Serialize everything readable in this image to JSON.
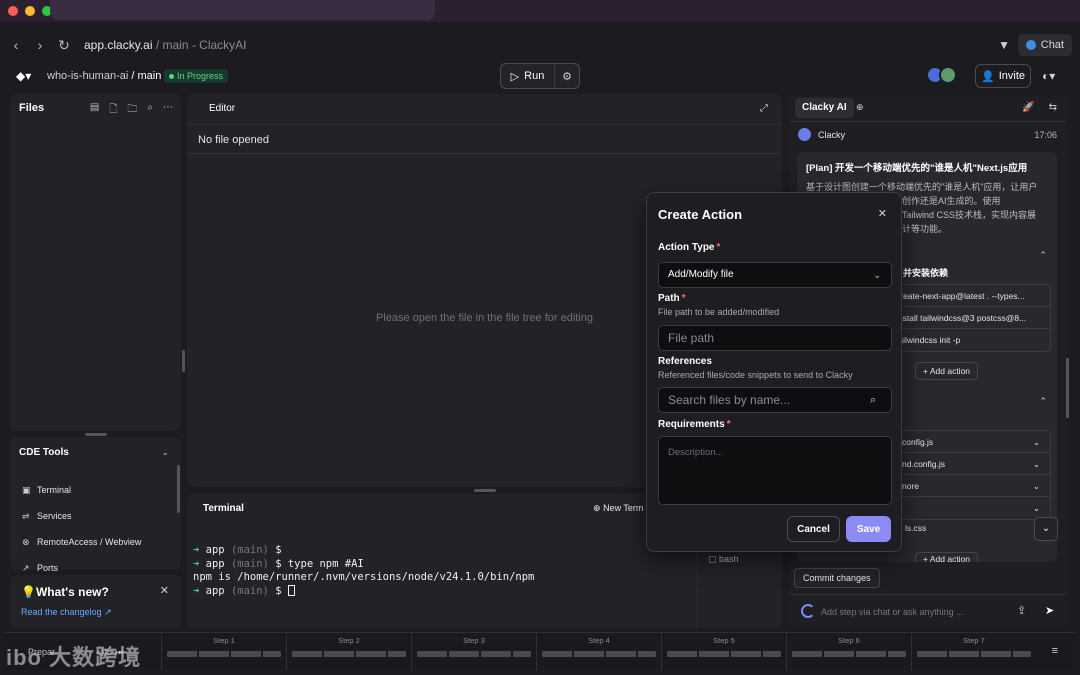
{
  "browser": {
    "url_host": "app.clacky.ai",
    "url_rest": " / main - ClackyAI",
    "chat_label": "Chat"
  },
  "header": {
    "project": "who-is-human-ai",
    "separator": "/",
    "branch": "main",
    "status": "In Progress",
    "run_label": "Run",
    "invite_label": "Invite"
  },
  "files": {
    "title": "Files"
  },
  "cde": {
    "title": "CDE Tools",
    "items": [
      {
        "icon": "terminal-icon",
        "label": "Terminal"
      },
      {
        "icon": "services-icon",
        "label": "Services"
      },
      {
        "icon": "remote-icon",
        "label": "RemoteAccess / Webview"
      },
      {
        "icon": "ports-icon",
        "label": "Ports"
      }
    ]
  },
  "news": {
    "title": "What's new?",
    "link": "Read the changelog ↗"
  },
  "editor": {
    "title": "Editor",
    "no_file": "No file opened",
    "empty_hint": "Please open the file in the file tree for editing"
  },
  "terminal": {
    "title": "Terminal",
    "new_terminal": "New Term",
    "side_tab": "bash",
    "lines": [
      {
        "arrow": "➜",
        "dir": "app",
        "branch": "(main)",
        "cmd": "$"
      },
      {
        "arrow": "➜",
        "dir": "app",
        "branch": "(main)",
        "cmd": "$ type npm #AI"
      },
      {
        "plain": "npm is /home/runner/.nvm/versions/node/v24.1.0/bin/npm"
      },
      {
        "arrow": "➜",
        "dir": "app",
        "branch": "(main)",
        "cmd": "$"
      }
    ]
  },
  "ai": {
    "tab_label": "Clacky AI",
    "sender": "Clacky",
    "time": "17:06",
    "plan_title": "[Plan] 开发一个移动端优先的\"谁是人机\"Next.js应用",
    "plan_desc_1": "基于设计图创建一个移动端优先的\"谁是人机\"应用，让用户",
    "plan_desc_2": "人类创作还是AI生成的。使用",
    "plan_desc_3": "Tailwind CSS技术栈，实现内容展",
    "plan_desc_4": "计等功能。",
    "step1_title": "并安装依赖",
    "commands": [
      "create-next-app@latest . --types...",
      "install tailwindcss@3 postcss@8...",
      "tailwindcss init -p"
    ],
    "add_action": "+ Add action",
    "files": [
      "config.js",
      "nd.config.js",
      "nore",
      ""
    ],
    "file_single": "ls.css",
    "commit_label": "Commit changes",
    "chat_placeholder": "Add step via chat or ask anything ..."
  },
  "bottom": {
    "prepare": "Prepar",
    "steps": [
      "Step 1",
      "Step 2",
      "Step 3",
      "Step 4",
      "Step 5",
      "Step 6",
      "Step 7"
    ]
  },
  "watermark": "ibo 大数跨境",
  "modal": {
    "title": "Create Action",
    "action_type_label": "Action Type",
    "action_type_value": "Add/Modify file",
    "path_label": "Path",
    "path_help": "File path to be added/modified",
    "path_placeholder": "File path",
    "references_label": "References",
    "references_help": "Referenced files/code snippets to send to Clacky",
    "references_placeholder": "Search files by name...",
    "requirements_label": "Requirements",
    "requirements_placeholder": "Description...",
    "required_mark": "*",
    "cancel_label": "Cancel",
    "save_label": "Save"
  }
}
